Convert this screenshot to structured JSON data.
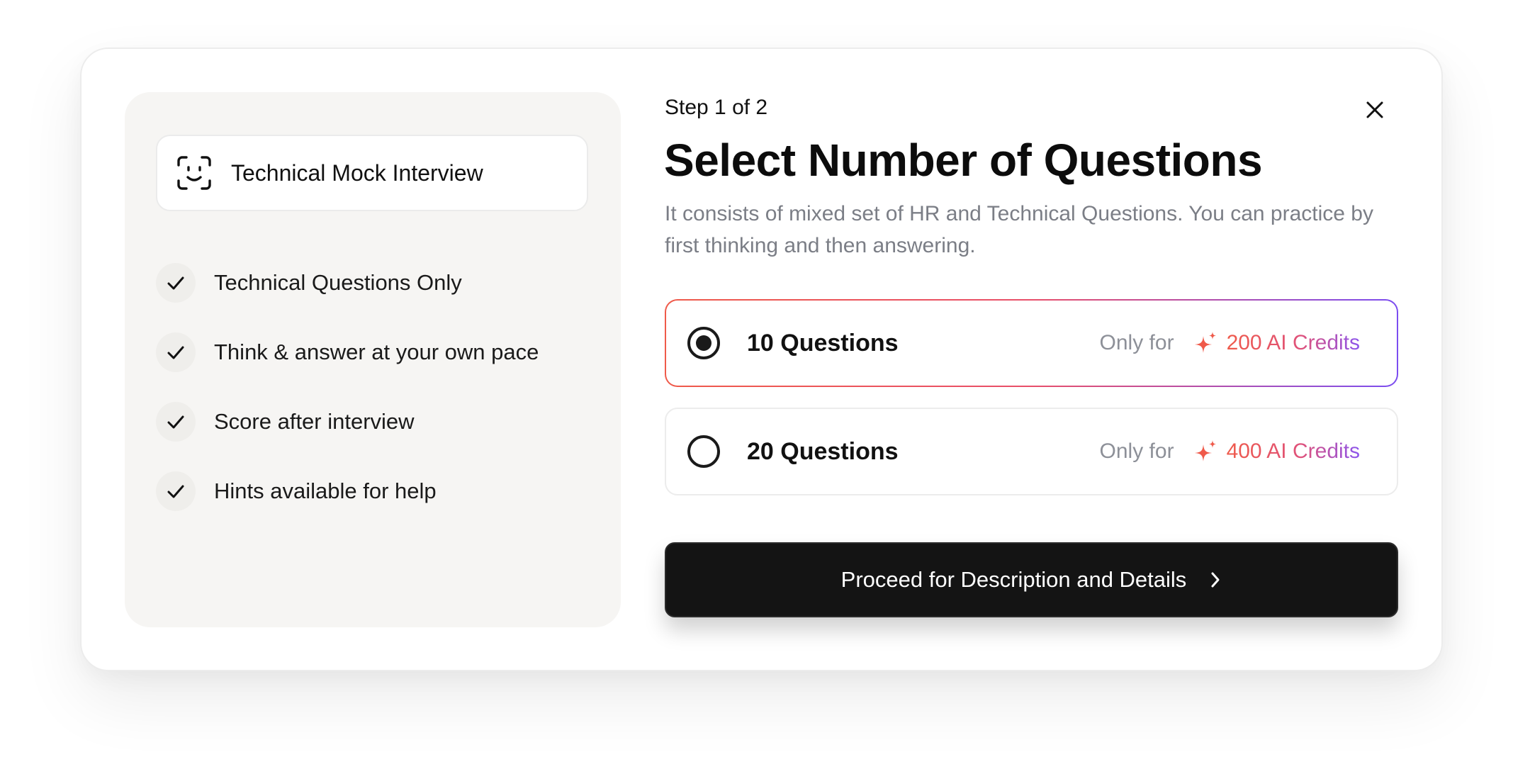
{
  "left_panel": {
    "mode": {
      "icon": "face-scan-icon",
      "title": "Technical Mock Interview"
    },
    "features": [
      {
        "icon": "check-icon",
        "label": "Technical Questions Only"
      },
      {
        "icon": "check-icon",
        "label": "Think & answer at your own pace"
      },
      {
        "icon": "check-icon",
        "label": "Score after interview"
      },
      {
        "icon": "check-icon",
        "label": "Hints available for help"
      }
    ]
  },
  "header": {
    "step": "Step 1 of 2",
    "title": "Select Number of Questions",
    "subtitle": "It consists of mixed set of HR and Technical Questions. You can practice by first thinking and then answering.",
    "close_icon": "close-icon"
  },
  "options": [
    {
      "label": "10 Questions",
      "price_prefix": "Only for",
      "credits": "200 AI Credits",
      "selected": true,
      "icon": "sparkle-icon"
    },
    {
      "label": "20 Questions",
      "price_prefix": "Only for",
      "credits": "400 AI Credits",
      "selected": false,
      "icon": "sparkle-icon"
    }
  ],
  "proceed": {
    "label": "Proceed for Description and Details",
    "icon": "chevron-right-icon"
  },
  "colors": {
    "accent_start": "#ef5a4a",
    "accent_end": "#7b4df0",
    "button_bg": "#141414",
    "panel_bg": "#f6f5f3",
    "muted_text": "#7b7e86"
  }
}
